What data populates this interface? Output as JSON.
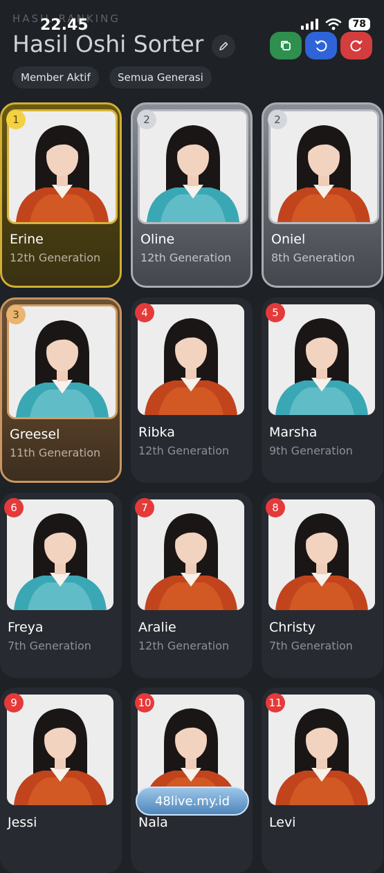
{
  "status_bar": {
    "time": "22.45",
    "battery": "78"
  },
  "header": {
    "eyebrow": "HASIL RANKING",
    "title": "Hasil Oshi Sorter",
    "edit_icon": "pencil-icon",
    "actions": [
      {
        "icon": "copy-icon",
        "color": "#2e8f4e"
      },
      {
        "icon": "undo-icon",
        "color": "#2e64d8"
      },
      {
        "icon": "redo-icon",
        "color": "#d33d3d"
      }
    ]
  },
  "filters": [
    "Member Aktif",
    "Semua Generasi"
  ],
  "members": [
    {
      "rank": "1",
      "name": "Erine",
      "generation": "12th Generation",
      "tier": "gold",
      "outfit": "orange"
    },
    {
      "rank": "2",
      "name": "Oline",
      "generation": "12th Generation",
      "tier": "silver",
      "outfit": "teal"
    },
    {
      "rank": "2",
      "name": "Oniel",
      "generation": "8th Generation",
      "tier": "silver",
      "outfit": "orange"
    },
    {
      "rank": "3",
      "name": "Greesel",
      "generation": "11th Generation",
      "tier": "bronze",
      "outfit": "teal"
    },
    {
      "rank": "4",
      "name": "Ribka",
      "generation": "12th Generation",
      "tier": "normal",
      "outfit": "orange"
    },
    {
      "rank": "5",
      "name": "Marsha",
      "generation": "9th Generation",
      "tier": "normal",
      "outfit": "teal"
    },
    {
      "rank": "6",
      "name": "Freya",
      "generation": "7th Generation",
      "tier": "normal",
      "outfit": "teal"
    },
    {
      "rank": "7",
      "name": "Aralie",
      "generation": "12th Generation",
      "tier": "normal",
      "outfit": "orange"
    },
    {
      "rank": "8",
      "name": "Christy",
      "generation": "7th Generation",
      "tier": "normal",
      "outfit": "orange"
    },
    {
      "rank": "9",
      "name": "Jessi",
      "generation": "",
      "tier": "normal",
      "outfit": "orange"
    },
    {
      "rank": "10",
      "name": "Nala",
      "generation": "",
      "tier": "normal",
      "outfit": "orange"
    },
    {
      "rank": "11",
      "name": "Levi",
      "generation": "",
      "tier": "normal",
      "outfit": "orange"
    }
  ],
  "watermark": "48live.my.id"
}
